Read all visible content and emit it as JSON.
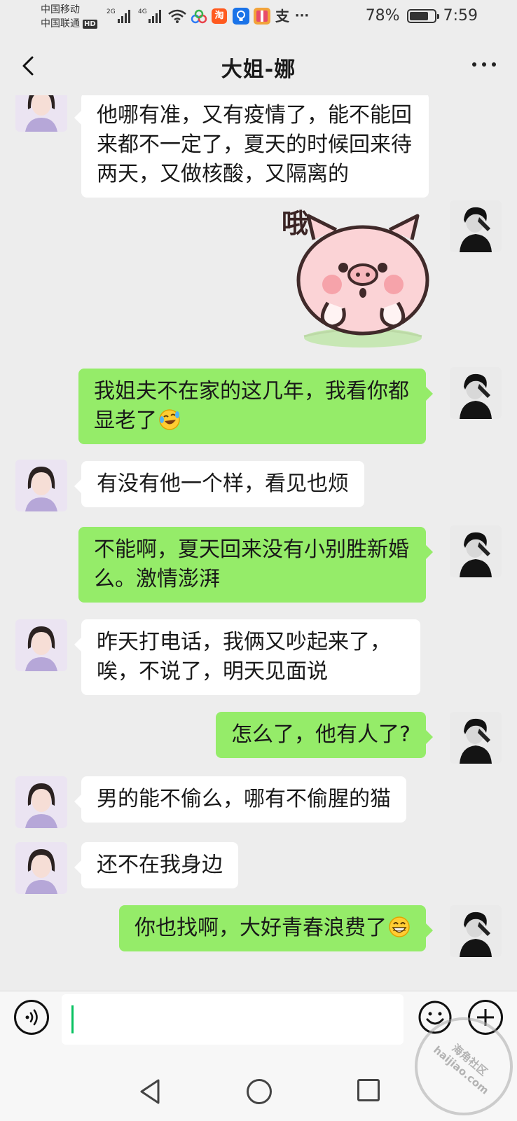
{
  "status_bar": {
    "carrier_1": "中国移动",
    "carrier_2": "中国联通",
    "hd_badge": "HD",
    "net_1": "2G",
    "net_2": "4G",
    "app_icon_taobao": "淘",
    "app_icon_alipay": "支",
    "overflow": "···",
    "battery_text": "78%",
    "battery_level": 0.78,
    "time": "7:59"
  },
  "nav": {
    "title": "大姐-娜",
    "back_icon": "chevron-left-icon",
    "more_icon": "more-dots-icon"
  },
  "messages": [
    {
      "from": "her",
      "text": "他哪有准，又有疫情了，能不能回\n来都不一定了，夏天的时候回来待\n两天，又做核酸，又隔离的"
    },
    {
      "from": "me",
      "type": "sticker",
      "text": "哦"
    },
    {
      "from": "me",
      "text": "我姐夫不在家的这几年，我看你都\n显老了",
      "emoji": "laughing-crying-emoji"
    },
    {
      "from": "her",
      "text": "有没有他一个样，看见也烦"
    },
    {
      "from": "me",
      "text": "不能啊，夏天回来没有小别胜新婚\n么。激情澎湃"
    },
    {
      "from": "her",
      "text": "昨天打电话，我俩又吵起来了，\n唉，不说了，明天见面说"
    },
    {
      "from": "me",
      "text": "怎么了，他有人了?"
    },
    {
      "from": "her",
      "text": "男的能不偷么，哪有不偷腥的猫"
    },
    {
      "from": "her",
      "text": "还不在我身边"
    },
    {
      "from": "me",
      "text": "你也找啊，大好青春浪费了",
      "emoji": "grinning-emoji"
    }
  ],
  "input_bar": {
    "voice_icon": "voice-icon",
    "text_value": "",
    "emoji_icon": "smiley-icon",
    "plus_icon": "plus-icon"
  },
  "system_nav": {
    "back_icon": "triangle-back-icon",
    "home_icon": "circle-home-icon",
    "recent_icon": "square-recent-icon"
  },
  "watermark": {
    "text": "海角社区 haijiao.com"
  },
  "colors": {
    "background": "#ededed",
    "bubble_out": "#95ec69",
    "bubble_in": "#ffffff",
    "accent": "#07c160"
  }
}
